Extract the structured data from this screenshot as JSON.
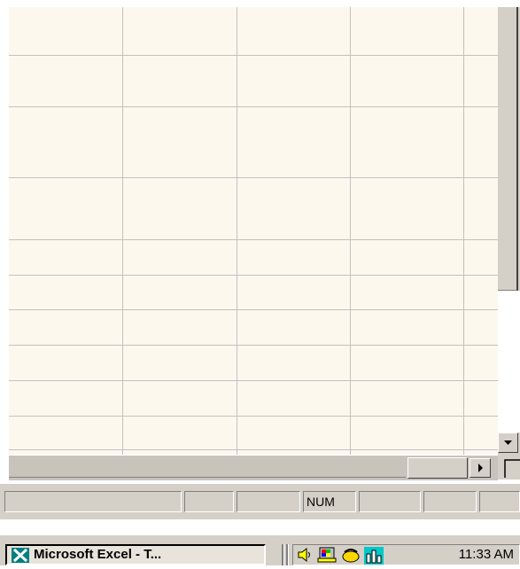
{
  "status": {
    "num_label": "NUM"
  },
  "taskbar": {
    "excel_task_label": "Microsoft Excel - T...",
    "clock": "11:33 AM"
  },
  "colors": {
    "sheet_bg": "#fcf8ee",
    "gridline": "#c4c0c0",
    "chrome": "#d4d0c8"
  }
}
